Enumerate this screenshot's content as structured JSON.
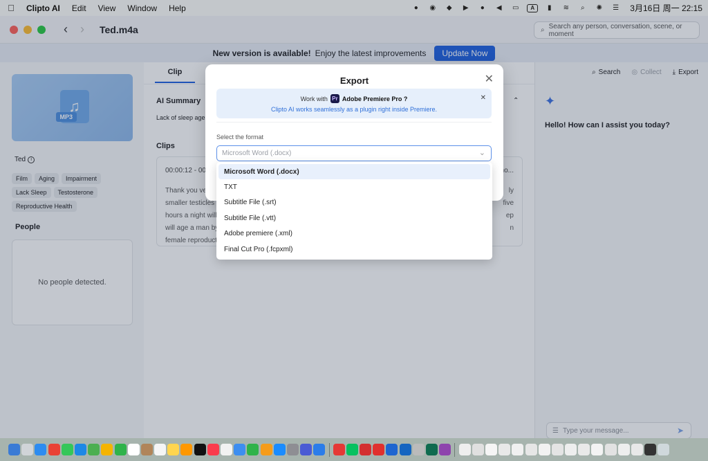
{
  "menubar": {
    "apple": "",
    "items": [
      "Clipto AI",
      "Edit",
      "View",
      "Window",
      "Help"
    ],
    "tray_a": "A",
    "clock": "3月16日 周一  22:15"
  },
  "window": {
    "title": "Ted.m4a",
    "search_placeholder": "Search any person, conversation, scene, or moment"
  },
  "banner": {
    "headline": "New version is available!",
    "text": "Enjoy the latest improvements",
    "button": "Update Now"
  },
  "sidebar": {
    "file_tag": "MP3",
    "speaker": "Ted",
    "tags": [
      "Film",
      "Aging",
      "Impairment",
      "Lack Sleep",
      "Testosterone",
      "Reproductive Health"
    ],
    "people_heading": "People",
    "people_empty": "No people detected."
  },
  "center": {
    "tab": "Clip",
    "ai_summary_heading": "AI Summary",
    "ai_summary_text": "Lack of sleep age",
    "clips_heading": "Clips",
    "clip_time": "00:00:12 - 00",
    "clip_time_right": "mo...",
    "clip_lines": [
      "Thank you ve",
      "smaller testicles",
      "hours a night will",
      "will age a man by",
      "female reproduct"
    ],
    "clip_lines_right": [
      "ly",
      "five",
      "ep",
      "n",
      ""
    ]
  },
  "right": {
    "tools": {
      "search": "Search",
      "collect": "Collect",
      "export": "Export"
    },
    "greeting": "Hello! How can I assist you today?",
    "message_placeholder": "Type your message..."
  },
  "modal": {
    "title": "Export",
    "premiere_prefix": "Work with",
    "premiere_badge": "Pr",
    "premiere_name": "Adobe Premiere Pro ?",
    "premiere_sub": "Clipto AI works seamlessly as a plugin right inside Premiere.",
    "format_label": "Select the format",
    "select_value": "Microsoft Word (.docx)",
    "options": [
      "Microsoft Word (.docx)",
      "TXT",
      "Subtitle File (.srt)",
      "Subtitle File (.vtt)",
      "Adobe premiere (.xml)",
      "Final Cut Pro (.fcpxml)"
    ]
  },
  "colors": {
    "accent": "#1d5fe0",
    "light_close": "#ff5f57",
    "light_min": "#febc2e",
    "light_max": "#28c840"
  }
}
